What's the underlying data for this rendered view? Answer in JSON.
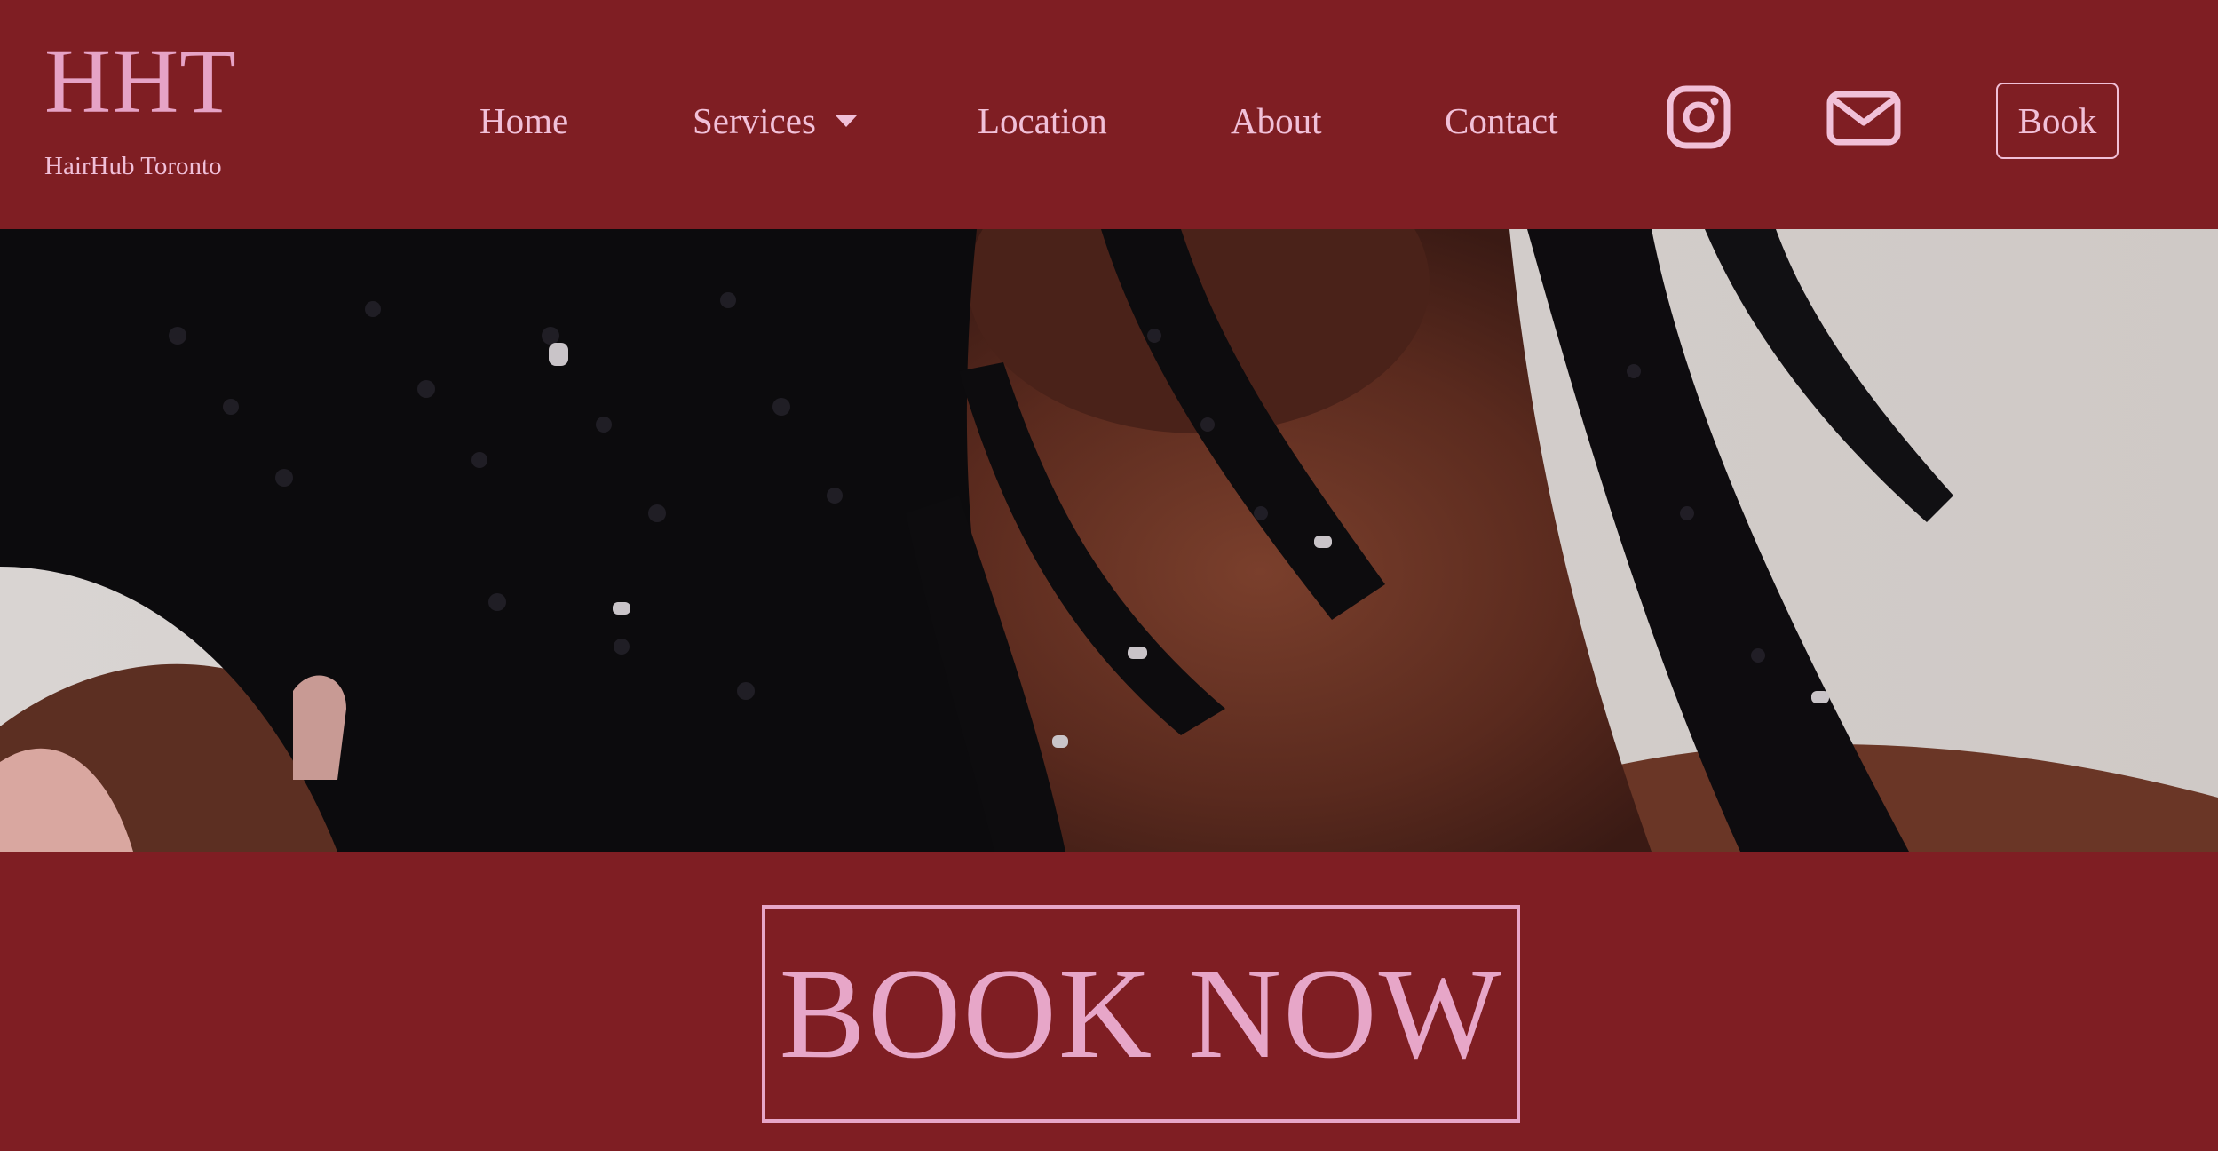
{
  "brand": {
    "title": "HHT",
    "subtitle": "HairHub Toronto"
  },
  "nav": {
    "home": "Home",
    "services": "Services",
    "location": "Location",
    "about": "About",
    "contact": "Contact",
    "book": "Book"
  },
  "icons": {
    "instagram": "instagram-icon",
    "email": "envelope-icon"
  },
  "hero": {
    "image": "woman-with-box-braids-photo"
  },
  "cta": {
    "label": "BOOK NOW"
  },
  "colors": {
    "background": "#7f1e23",
    "accent_pink": "#e7a6c8"
  }
}
